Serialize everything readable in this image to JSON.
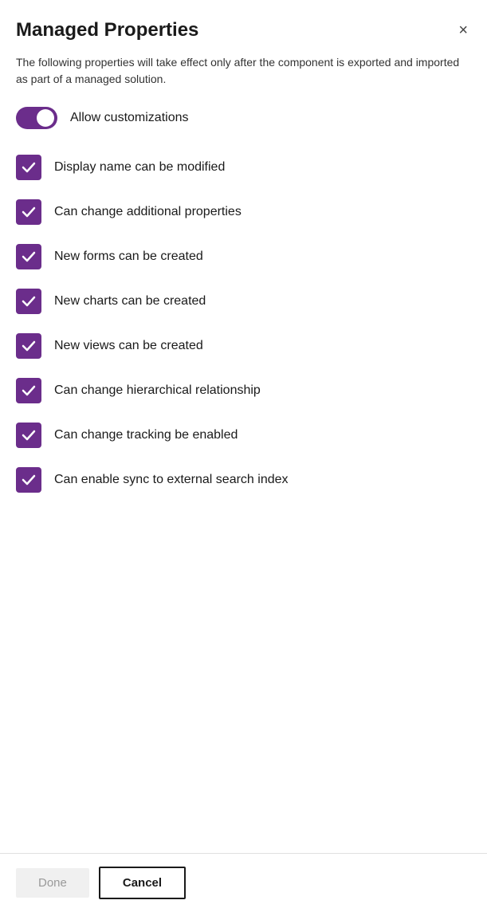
{
  "dialog": {
    "title": "Managed Properties",
    "description": "The following properties will take effect only after the component is exported and imported as part of a managed solution.",
    "close_label": "×"
  },
  "toggle": {
    "label": "Allow customizations",
    "checked": true
  },
  "checkboxes": [
    {
      "id": "cb1",
      "label": "Display name can be modified",
      "checked": true
    },
    {
      "id": "cb2",
      "label": "Can change additional properties",
      "checked": true
    },
    {
      "id": "cb3",
      "label": "New forms can be created",
      "checked": true
    },
    {
      "id": "cb4",
      "label": "New charts can be created",
      "checked": true
    },
    {
      "id": "cb5",
      "label": "New views can be created",
      "checked": true
    },
    {
      "id": "cb6",
      "label": "Can change hierarchical relationship",
      "checked": true
    },
    {
      "id": "cb7",
      "label": "Can change tracking be enabled",
      "checked": true
    },
    {
      "id": "cb8",
      "label": "Can enable sync to external search index",
      "checked": true
    }
  ],
  "footer": {
    "done_label": "Done",
    "cancel_label": "Cancel"
  },
  "colors": {
    "accent": "#6b2d8b"
  }
}
